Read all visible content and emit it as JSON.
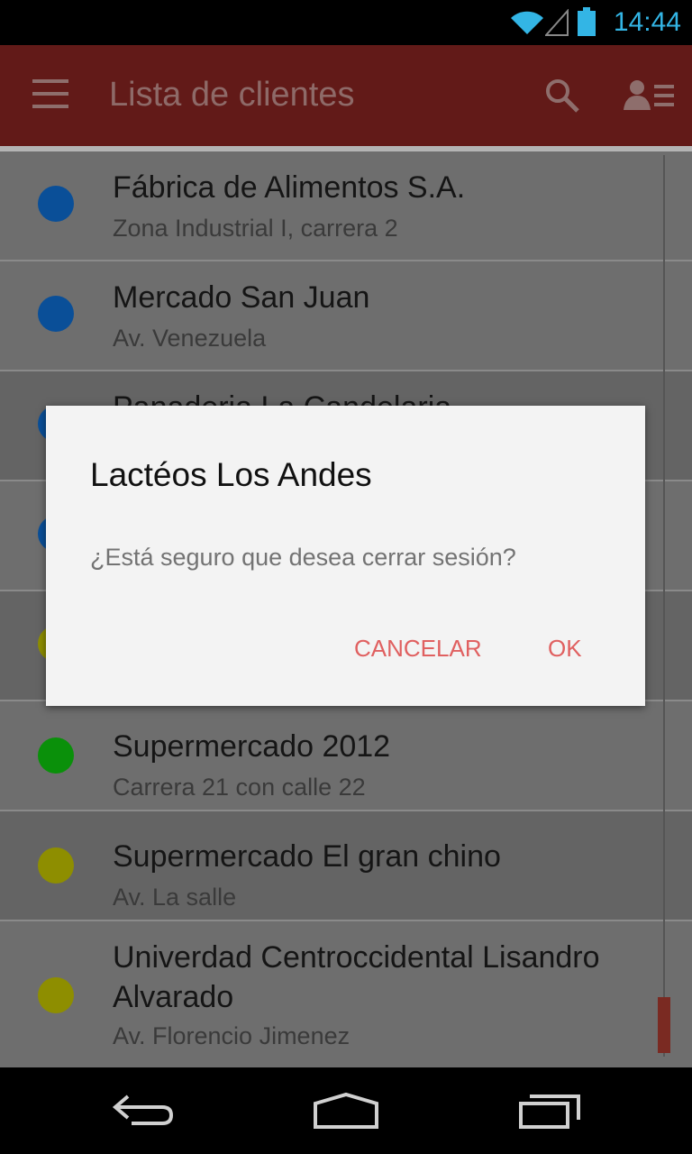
{
  "status_bar": {
    "time": "14:44",
    "icons": [
      "wifi-icon",
      "signal-icon",
      "battery-icon"
    ],
    "color": "#33b5e5"
  },
  "app_bar": {
    "title": "Lista de clientes",
    "icons": [
      "menu-icon",
      "search-icon",
      "profile-list-icon"
    ],
    "color": "#621a18"
  },
  "clients": [
    {
      "name": "Fábrica de Alimentos S.A.",
      "address": "Zona Industrial I, carrera 2",
      "dot_color": "#0a4f98"
    },
    {
      "name": "Mercado San Juan",
      "address": "Av. Venezuela",
      "dot_color": "#0a4f98"
    },
    {
      "name": "Panaderia La Candelaria",
      "address": "",
      "dot_color": "#0a4f98"
    },
    {
      "name": "",
      "address": "",
      "dot_color": "#0a4f98"
    },
    {
      "name": "",
      "address": "",
      "dot_color": "#8e8e00"
    },
    {
      "name": "Supermercado 2012",
      "address": "Carrera 21 con calle 22",
      "dot_color": "#0a900a"
    },
    {
      "name": "Supermercado El gran chino",
      "address": "Av. La salle",
      "dot_color": "#8e8e00"
    },
    {
      "name": "Univerdad Centroccidental Lisandro Alvarado",
      "address": "Av. Florencio Jimenez",
      "dot_color": "#8e8e00"
    }
  ],
  "dialog": {
    "title": "Lactéos Los Andes",
    "message": "¿Está seguro que desea cerrar sesión?",
    "cancel_label": "CANCELAR",
    "ok_label": "OK",
    "button_color": "#e06060"
  },
  "nav_bar": {
    "icons": [
      "back-icon",
      "home-icon",
      "recents-icon"
    ]
  }
}
